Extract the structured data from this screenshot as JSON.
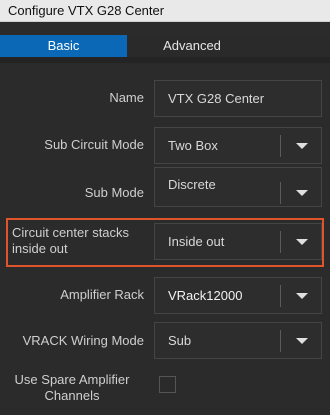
{
  "window": {
    "title": "Configure VTX G28 Center"
  },
  "tabs": [
    {
      "label": "Basic"
    },
    {
      "label": "Advanced"
    }
  ],
  "form": {
    "name": {
      "label": "Name",
      "value": "VTX G28 Center"
    },
    "sub_circuit_mode": {
      "label": "Sub Circuit Mode",
      "value": "Two Box"
    },
    "sub_mode": {
      "label": "Sub Mode",
      "value": "Discrete"
    },
    "circuit_center_stacks": {
      "label_line1": "Circuit center stacks",
      "label_line2": "inside out",
      "value": "Inside out"
    },
    "amplifier_rack": {
      "label": "Amplifier Rack",
      "value": "VRack12000"
    },
    "vrack_wiring_mode": {
      "label": "VRACK Wiring Mode",
      "value": "Sub"
    },
    "use_spare_amplifier_channels": {
      "label_line1": "Use Spare Amplifier",
      "label_line2": "Channels",
      "checked": false
    }
  },
  "colors": {
    "accent": "#0a68b6",
    "highlight": "#e0542b",
    "background": "#2b2b2b"
  }
}
